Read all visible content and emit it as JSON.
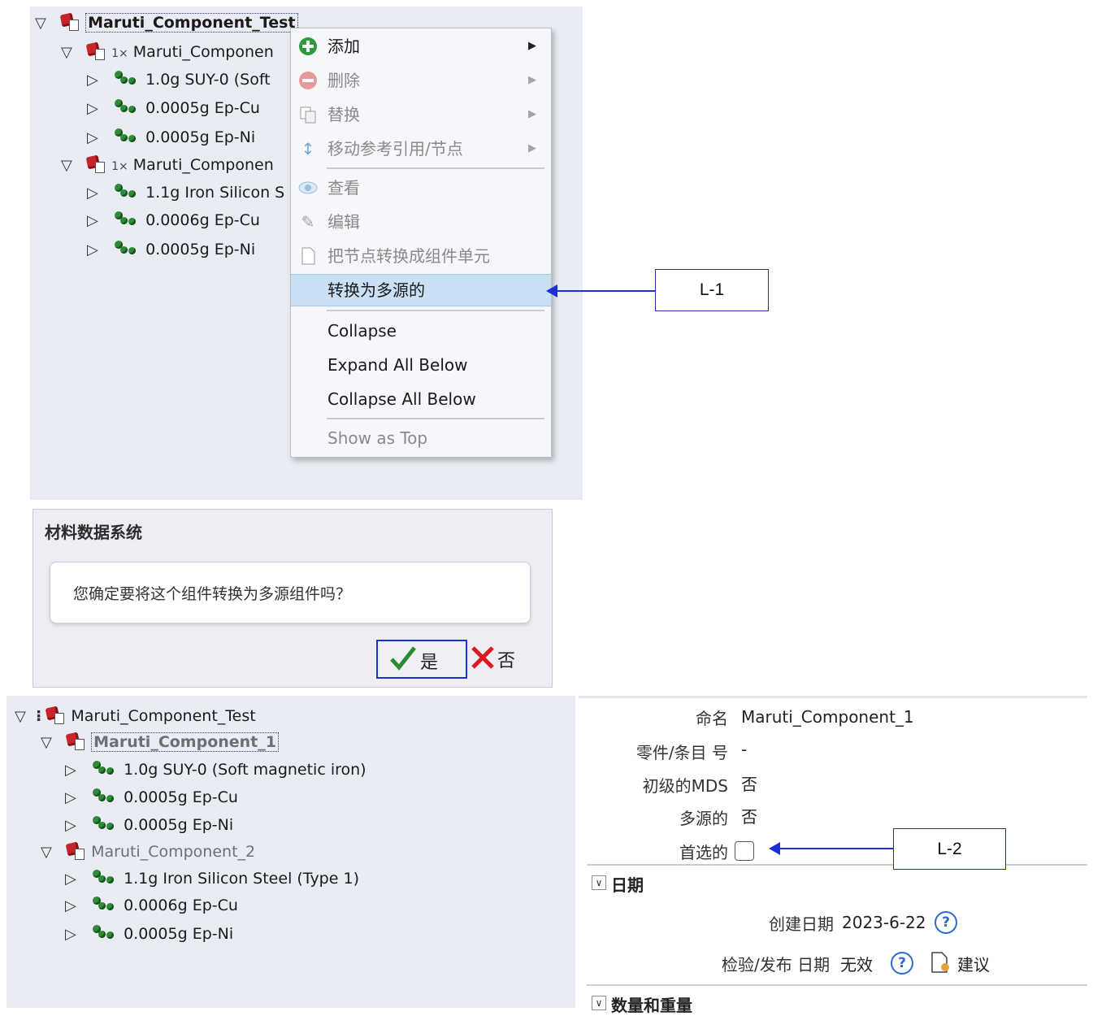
{
  "tree_top": {
    "root": "Maruti_Component_Test",
    "children": [
      {
        "mult": "1×",
        "name": "Maruti_Componen",
        "materials": [
          {
            "weight": "1.0g",
            "name": "SUY-0 (Soft"
          },
          {
            "weight": "0.0005g",
            "name": "Ep-Cu"
          },
          {
            "weight": "0.0005g",
            "name": "Ep-Ni"
          }
        ]
      },
      {
        "mult": "1×",
        "name": "Maruti_Componen",
        "materials": [
          {
            "weight": "1.1g",
            "name": "Iron Silicon S"
          },
          {
            "weight": "0.0006g",
            "name": "Ep-Cu"
          },
          {
            "weight": "0.0005g",
            "name": "Ep-Ni"
          }
        ]
      }
    ]
  },
  "context_menu": {
    "add": "添加",
    "delete": "删除",
    "replace": "替换",
    "move_ref": "移动参考引用/节点",
    "view": "查看",
    "edit": "编辑",
    "convert_node": "把节点转换成组件单元",
    "convert_multi": "转换为多源的",
    "collapse": "Collapse",
    "expand_all": "Expand All Below",
    "collapse_all": "Collapse All Below",
    "show_top": "Show as Top"
  },
  "callouts": {
    "l1": "L-1",
    "l2": "L-2"
  },
  "dialog": {
    "title": "材料数据系统",
    "message": "您确定要将这个组件转换为多源组件吗？",
    "yes": "是",
    "no": "否"
  },
  "tree_bottom": {
    "root": "Maruti_Component_Test",
    "children": [
      {
        "name": "Maruti_Component_1",
        "materials": [
          {
            "weight": "1.0g",
            "name": "SUY-0 (Soft magnetic iron)"
          },
          {
            "weight": "0.0005g",
            "name": "Ep-Cu"
          },
          {
            "weight": "0.0005g",
            "name": "Ep-Ni"
          }
        ]
      },
      {
        "name": "Maruti_Component_2",
        "materials": [
          {
            "weight": "1.1g",
            "name": "Iron Silicon Steel (Type 1)"
          },
          {
            "weight": "0.0006g",
            "name": "Ep-Cu"
          },
          {
            "weight": "0.0005g",
            "name": "Ep-Ni"
          }
        ]
      }
    ]
  },
  "properties": {
    "name_label": "命名",
    "name_value": "Maruti_Component_1",
    "part_label": "零件/条目 号",
    "part_value": "-",
    "primary_label": "初级的MDS",
    "primary_value": "否",
    "multi_label": "多源的",
    "multi_value": "否",
    "preferred_label": "首选的",
    "dates_section": "日期",
    "created_label": "创建日期",
    "created_value": "2023-6-22",
    "check_label": "检验/发布 日期",
    "check_value": "无效",
    "suggest_label": "建议",
    "qty_section": "数量和重量"
  },
  "colors": {
    "accent": "#1d2fd6",
    "highlight": "#c9e0f5",
    "component_icon": "#c8242c",
    "material_icon": "#2e8b3a"
  }
}
